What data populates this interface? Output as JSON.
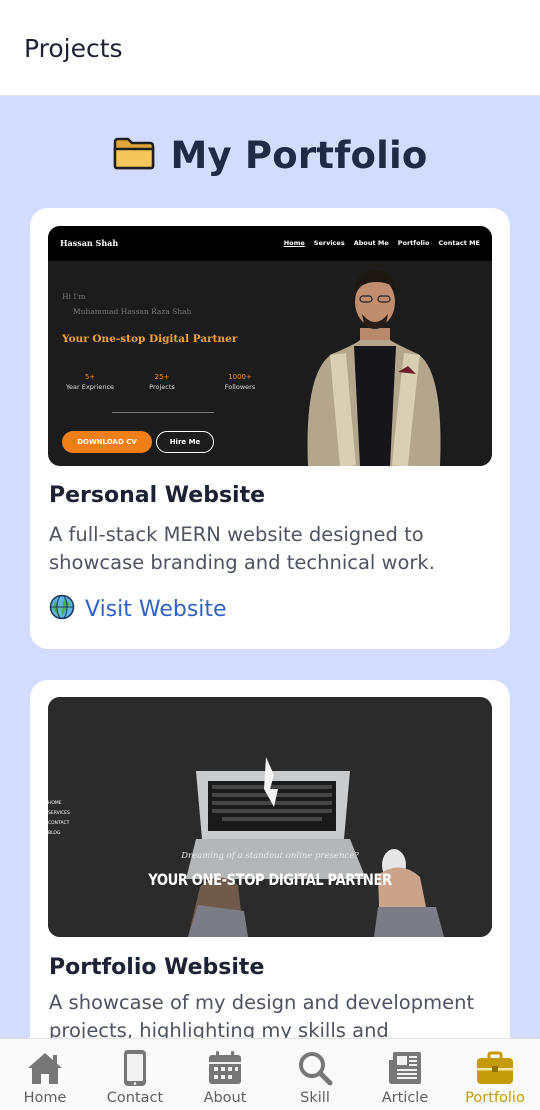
{
  "header": {
    "title": "Projects"
  },
  "section": {
    "heading": "My Portfolio",
    "icon": "folder-icon"
  },
  "projects": [
    {
      "title": "Personal Website",
      "description": "A full-stack MERN website designed to showcase branding and technical work.",
      "link_label": "Visit Website",
      "link_icon": "globe-icon",
      "preview": {
        "brand": "Hassan Shah",
        "nav": [
          "Home",
          "Services",
          "About Me",
          "Portfolio",
          "Contact ME"
        ],
        "greeting": "Hi I'm",
        "name": "Muhammad Hassan Raza Shah",
        "tagline": "Your One-stop Digital Partner",
        "stats": [
          {
            "value": "5+",
            "label": "Year Exprience"
          },
          {
            "value": "25+",
            "label": "Projects"
          },
          {
            "value": "1000+",
            "label": "Followers"
          }
        ],
        "primary_button": "DOWNLOAD CV",
        "secondary_button": "Hire Me"
      }
    },
    {
      "title": "Portfolio Website",
      "description": "A showcase of my design and development projects, highlighting my skills and creativity.",
      "preview": {
        "menu": [
          "HOME",
          "SERVICES",
          "CONTACT",
          "BLOG"
        ],
        "subheading": "Dreaming of a standout online presence?",
        "heading": "YOUR ONE-STOP DIGITAL PARTNER"
      }
    }
  ],
  "bottom_nav": {
    "items": [
      {
        "label": "Home",
        "icon": "home-icon"
      },
      {
        "label": "Contact",
        "icon": "phone-icon"
      },
      {
        "label": "About",
        "icon": "calendar-icon"
      },
      {
        "label": "Skill",
        "icon": "search-icon"
      },
      {
        "label": "Article",
        "icon": "newspaper-icon"
      },
      {
        "label": "Portfolio",
        "icon": "briefcase-icon"
      }
    ],
    "active": "Portfolio",
    "active_color": "#c49b08",
    "inactive_color": "#777777"
  },
  "colors": {
    "background": "#d2dcff",
    "link": "#2e63c4",
    "accent": "#f07f17"
  }
}
